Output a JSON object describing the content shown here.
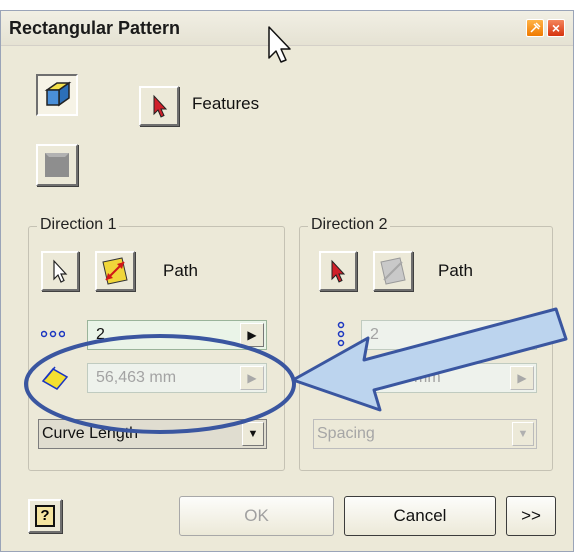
{
  "dialog": {
    "title": "Rectangular Pattern",
    "close_glyph": "×"
  },
  "features": {
    "label": "Features"
  },
  "direction1": {
    "title": "Direction 1",
    "path_label": "Path",
    "count": {
      "value": "2"
    },
    "spacing": {
      "value": "56,463 mm"
    },
    "mode": {
      "value": "Curve Length"
    }
  },
  "direction2": {
    "title": "Direction 2",
    "path_label": "Path",
    "count": {
      "value": "2"
    },
    "spacing": {
      "value": "mm"
    },
    "mode": {
      "value": "Spacing"
    }
  },
  "buttons": {
    "help": "?",
    "ok": "OK",
    "cancel": "Cancel",
    "more": ">>"
  },
  "icons": {
    "rect-feature": "rect-feature-icon",
    "solid": "solid-body-icon",
    "select": "select-arrow-icon",
    "flip": "flip-direction-icon",
    "count": "count-dots-icon",
    "distance": "distance-icon",
    "dropdown": "chevron-down-icon"
  },
  "colors": {
    "annotation": "#3a56a0",
    "arrow_fill": "#bcd4ee",
    "dialog_bg": "#ece9d8"
  }
}
